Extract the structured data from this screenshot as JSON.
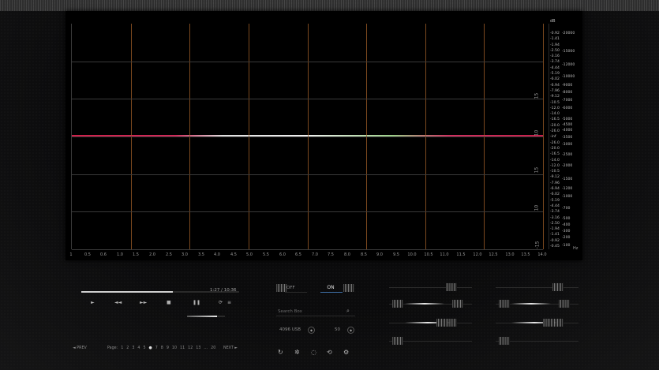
{
  "plot": {
    "db_unit": "dB",
    "hz_unit": "Hz",
    "x_ticks": [
      "1",
      "0.5",
      "0.6",
      "1.0",
      "1.5",
      "2.0",
      "2.5",
      "3.0",
      "3.5",
      "4.0",
      "4.5",
      "5.0",
      "5.5",
      "6.0",
      "6.5",
      "7.0",
      "7.5",
      "8.0",
      "8.5",
      "9.0",
      "9.5",
      "10.0",
      "10.5",
      "11.0",
      "11.5",
      "12.0",
      "12.5",
      "13.0",
      "13.5",
      "14.0"
    ],
    "x_unit": "Hz",
    "db_side_labels": [
      "15",
      "10",
      "15",
      "10",
      "-15"
    ],
    "db_values": [
      "-0.92",
      "-1.41",
      "-1.94",
      "-2.50",
      "-3.16",
      "-3.74",
      "-4.44",
      "-5.19",
      "-6.02",
      "-6.94",
      "-7.96",
      "-9.12",
      "-10.5",
      "-12.0",
      "-14.0",
      "-16.5",
      "-20.0",
      "-26.0",
      "-inf",
      "-26.0",
      "-20.0",
      "-16.5",
      "-14.0",
      "-12.0",
      "-10.5",
      "-9.12",
      "-7.96",
      "-6.94",
      "-6.02",
      "-5.19",
      "-4.44",
      "-3.74",
      "-3.16",
      "-2.50",
      "-1.94",
      "-1.41",
      "-0.92",
      "-0.45"
    ],
    "hz_values": [
      "20000",
      "15000",
      "12000",
      "10000",
      "9000",
      "8000",
      "7000",
      "6000",
      "5000",
      "4500",
      "4000",
      "3500",
      "3000",
      "2500",
      "2000",
      "1500",
      "1200",
      "1000",
      "700",
      "500",
      "400",
      "300",
      "200",
      "100"
    ]
  },
  "transport": {
    "time": "1:27 / 10:36",
    "seek_fraction": 0.58,
    "volume_fraction": 0.8,
    "buttons": [
      "►",
      "◄◄",
      "►►",
      "■",
      "❚❚",
      "⟳",
      "≡"
    ]
  },
  "pager": {
    "prev": "◄ PREV",
    "next": "NEXT ►",
    "label": "Page:",
    "pages": [
      "1",
      "2",
      "3",
      "4",
      "5",
      "6",
      "7",
      "8",
      "9",
      "10",
      "11",
      "12",
      "13"
    ],
    "current": "6",
    "total": "20"
  },
  "toggle": {
    "off": "OFF",
    "on": "ON"
  },
  "search": {
    "placeholder": "Search Box"
  },
  "selectors": {
    "left": "4096 USB",
    "right": "50"
  },
  "icons": [
    "refresh-icon",
    "gear-icon",
    "reload-icon",
    "sync-icon",
    "settings-icon"
  ],
  "colors": {
    "accent": "#3f6fa7",
    "grid_v": "#a6622a",
    "level_red": "#d0204a"
  }
}
